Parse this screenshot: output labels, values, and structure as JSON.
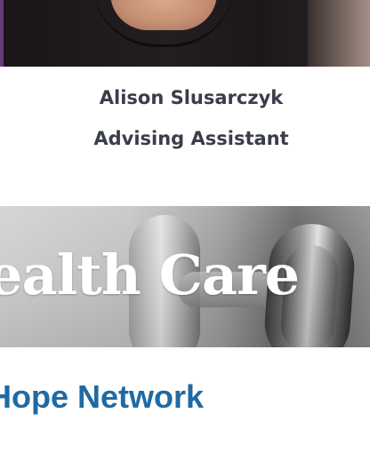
{
  "profile": {
    "name": "Alison Slusarczyk",
    "role": "Advising Assistant"
  },
  "banner": {
    "title": "ealth Care"
  },
  "section": {
    "heading": "Hope Network"
  },
  "colors": {
    "heading_blue": "#1f6aa5",
    "name_text": "#3a3d4a",
    "photo_edge_purple": "#6b3a7a"
  }
}
